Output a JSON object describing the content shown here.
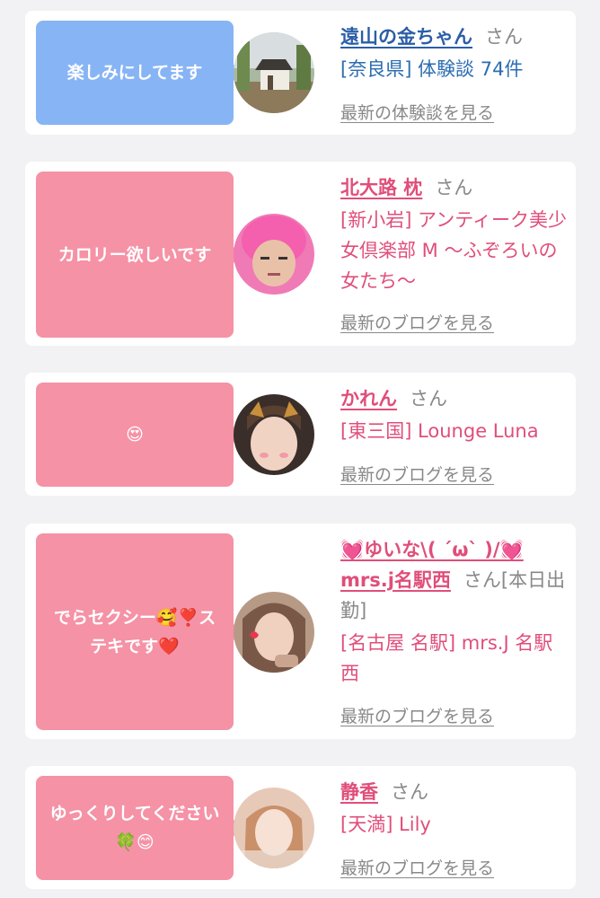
{
  "cards": [
    {
      "bubble": "楽しみにしてます",
      "name": "遠山の金ちゃん",
      "san": "さん",
      "detail": "[奈良県] 体験談 74件",
      "more": "最新の体験談を見る"
    },
    {
      "bubble": "カロリー欲しいです",
      "name": "北大路 枕",
      "san": "さん",
      "detail": "[新小岩] アンティーク美少女倶楽部 M 〜ふぞろいの女たち〜",
      "more": "最新のブログを見る"
    },
    {
      "bubble": "😍",
      "name": "かれん",
      "san": "さん",
      "detail": "[東三国] Lounge Luna",
      "more": "最新のブログを見る"
    },
    {
      "bubble": "でらセクシー🥰❣️ステキです❤️",
      "name": "💓ゆいな\\( ´ω` )/💓mrs.j名駅西",
      "san": "さん[本日出勤]",
      "detail": "[名古屋 名駅] mrs.J 名駅西",
      "more": "最新のブログを見る"
    },
    {
      "bubble": "ゆっくりしてください🍀😊",
      "name": "静香",
      "san": "さん",
      "detail": "[天満] Lily",
      "more": "最新のブログを見る"
    }
  ],
  "colors": {
    "blue_bubble": "#87b4f4",
    "pink_bubble": "#f592a6",
    "name_blue": "#2b5ea6",
    "name_pink": "#e04e7a"
  }
}
